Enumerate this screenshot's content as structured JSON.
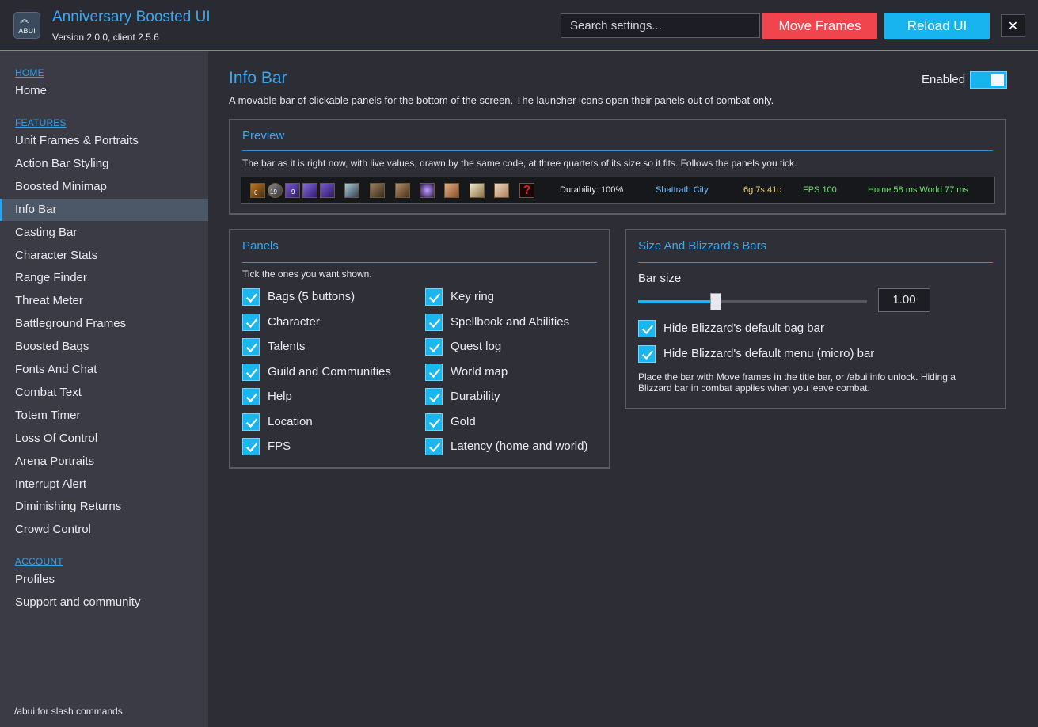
{
  "app": {
    "logo_text": "ABUI",
    "title": "Anniversary Boosted UI",
    "version": "Version 2.0.0, client 2.5.6"
  },
  "header": {
    "search_placeholder": "Search settings...",
    "move_frames": "Move Frames",
    "reload_ui": "Reload UI",
    "close": "✕",
    "colors": {
      "move": "#f0454d",
      "reload": "#17b4f0",
      "accent": "#3aa8ef"
    }
  },
  "sidebar": {
    "home_head": "HOME",
    "home_items": [
      "Home"
    ],
    "features_head": "FEATURES",
    "features_items": [
      "Unit Frames & Portraits",
      "Action Bar Styling",
      "Boosted Minimap",
      "Info Bar",
      "Casting Bar",
      "Character Stats",
      "Range Finder",
      "Threat Meter",
      "Battleground Frames",
      "Boosted Bags",
      "Fonts And Chat",
      "Combat Text",
      "Totem Timer",
      "Loss Of Control",
      "Arena Portraits",
      "Interrupt Alert",
      "Diminishing Returns",
      "Crowd Control"
    ],
    "active_item": "Info Bar",
    "account_head": "ACCOUNT",
    "account_items": [
      "Profiles",
      "Support and community"
    ],
    "footer": "/abui for slash commands"
  },
  "page": {
    "title": "Info Bar",
    "description": "A movable bar of clickable panels for the bottom of the screen.  The launcher icons open their panels out of combat only.",
    "enabled_label": "Enabled",
    "enabled": true
  },
  "preview": {
    "title": "Preview",
    "description": "The bar as it is right now, with live values, drawn by the same code, at three quarters of its size so it fits.  Follows the panels you tick.",
    "bag_counts": [
      "6",
      "19",
      "9",
      "",
      ""
    ],
    "durability": "Durability: 100%",
    "location": "Shattrath City",
    "gold": "6g 7s 41c",
    "fps": "FPS 100",
    "latency": "Home 58 ms  World 77 ms"
  },
  "panels": {
    "title": "Panels",
    "hint": "Tick the ones you want shown.",
    "left": [
      {
        "label": "Bags (5 buttons)",
        "checked": true
      },
      {
        "label": "Character",
        "checked": true
      },
      {
        "label": "Talents",
        "checked": true
      },
      {
        "label": "Guild and Communities",
        "checked": true
      },
      {
        "label": "Help",
        "checked": true
      },
      {
        "label": "Location",
        "checked": true
      },
      {
        "label": "FPS",
        "checked": true
      }
    ],
    "right": [
      {
        "label": "Key ring",
        "checked": true
      },
      {
        "label": "Spellbook and Abilities",
        "checked": true
      },
      {
        "label": "Quest log",
        "checked": true
      },
      {
        "label": "World map",
        "checked": true
      },
      {
        "label": "Durability",
        "checked": true
      },
      {
        "label": "Gold",
        "checked": true
      },
      {
        "label": "Latency (home and world)",
        "checked": true
      }
    ]
  },
  "size_panel": {
    "title": "Size And Blizzard's Bars",
    "bar_size_label": "Bar size",
    "bar_size_value": "1.00",
    "slider_fraction": 0.34,
    "options": [
      {
        "label": "Hide Blizzard's default bag bar",
        "checked": true
      },
      {
        "label": "Hide Blizzard's default menu (micro) bar",
        "checked": true
      }
    ],
    "note_line1": "Place the bar with Move frames in the title bar, or /abui info unlock.  Hiding a",
    "note_line2": "Blizzard bar in combat applies when you leave combat."
  }
}
